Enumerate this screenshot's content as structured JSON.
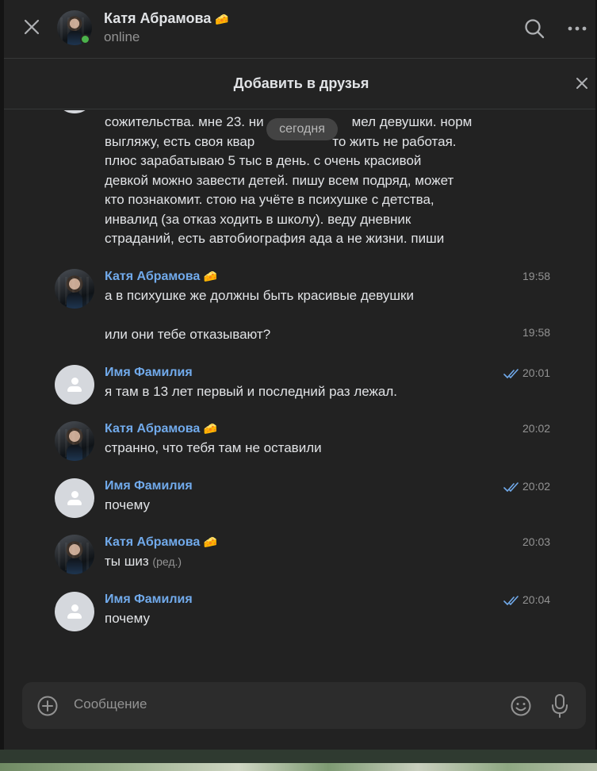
{
  "header": {
    "contact_name": "Катя Абрамова",
    "status": "online",
    "close_icon": "close-icon",
    "search_icon": "search-icon",
    "more_icon": "more-icon"
  },
  "add_friend": {
    "label": "Добавить в друзья"
  },
  "date_divider": "сегодня",
  "messages": [
    {
      "lines": [
        "сожительства. мне 23. ни",
        "выгляжу, есть своя квар",
        "плюс зарабатываю 5 тыс в день. с очень красивой",
        "девкой можно завести детей. пишу всем подряд, может",
        "кто познакомит. стою на учёте в психушке с детства,",
        "инвалид (за отказ ходить в школу). веду дневник",
        "страданий, есть автобиография ада а не жизни. пиши"
      ],
      "line1_tail": "мел девушки. норм",
      "line2_tail": "то жить не работая."
    },
    {
      "name": "Катя Абрамова",
      "badge": "🧀",
      "time": "19:58",
      "text": "а в психушке же должны быть красивые девушки"
    },
    {
      "time": "19:58",
      "text": "или они тебе отказывают?"
    },
    {
      "name": "Имя Фамилия",
      "time": "20:01",
      "text": "я там в 13 лет первый и последний раз лежал."
    },
    {
      "name": "Катя Абрамова",
      "badge": "🧀",
      "time": "20:02",
      "text": "странно, что тебя там не оставили"
    },
    {
      "name": "Имя Фамилия",
      "time": "20:02",
      "text": "почему"
    },
    {
      "name": "Катя Абрамова",
      "badge": "🧀",
      "time": "20:03",
      "text": "ты шиз",
      "edited": "(ред.)"
    },
    {
      "name": "Имя Фамилия",
      "time": "20:04",
      "text": "почему"
    }
  ],
  "composer": {
    "placeholder": "Сообщение",
    "attach_icon": "plus-circle-icon",
    "emoji_icon": "smile-icon",
    "mic_icon": "microphone-icon"
  },
  "colors": {
    "background": "#222222",
    "name_link": "#71aaeb",
    "text": "#e1e3e6",
    "muted": "#939393",
    "online": "#4bb34b",
    "read_ticks": "#71aaeb"
  }
}
